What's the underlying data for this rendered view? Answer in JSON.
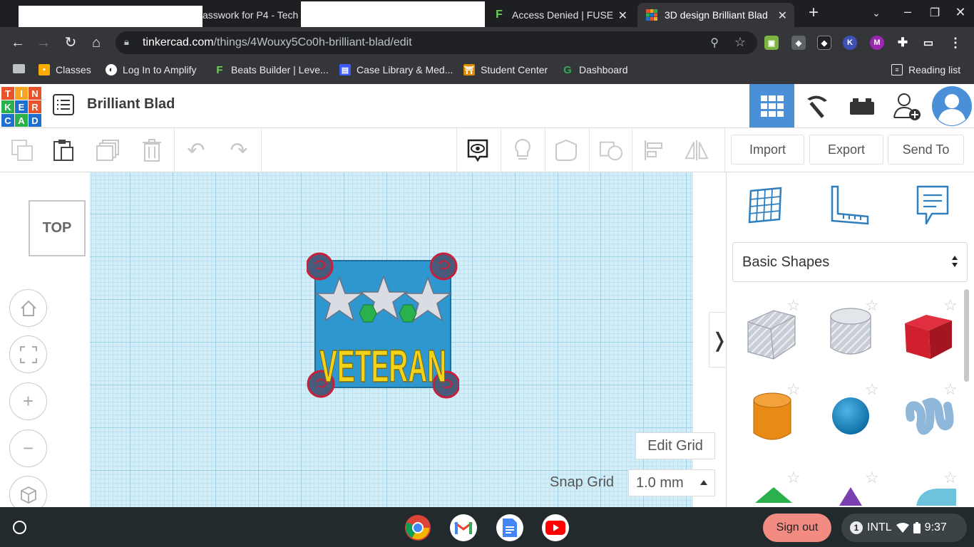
{
  "browser": {
    "tabs": [
      {
        "title": "asswork for P4 - Tech",
        "active": false
      },
      {
        "title": "Access Denied | FUSE",
        "active": false
      },
      {
        "title": "3D design Brilliant Blad",
        "active": true
      }
    ],
    "new_tab_icon": "plus-icon",
    "url_host": "tinkercad.com",
    "url_path": "/things/4Wouxy5Co0h-brilliant-blad/edit",
    "bookmarks": [
      {
        "label": "Classes"
      },
      {
        "label": "Log In to Amplify"
      },
      {
        "label": "Beats Builder | Leve..."
      },
      {
        "label": "Case Library & Med..."
      },
      {
        "label": "Student Center"
      },
      {
        "label": "Dashboard"
      }
    ],
    "reading_list": "Reading list"
  },
  "app": {
    "logo_letters": [
      "T",
      "I",
      "N",
      "K",
      "E",
      "R",
      "C",
      "A",
      "D"
    ],
    "design_title": "Brilliant Blad",
    "actions": {
      "import": "Import",
      "export": "Export",
      "send_to": "Send To"
    },
    "viewcube_label": "TOP",
    "model_text": "VETERAN",
    "edit_grid": "Edit Grid",
    "snap_grid_label": "Snap Grid",
    "snap_grid_value": "1.0 mm",
    "shape_category": "Basic Shapes",
    "colors": {
      "accent_blue": "#4a90d9",
      "workplane": "#d4edf7",
      "model_blue": "#2f97d0",
      "model_yellow": "#f2d21b",
      "box_red": "#d0202e",
      "cylinder_orange": "#e98a15",
      "sphere_blue": "#1b8fcf"
    }
  },
  "shelf": {
    "sign_out": "Sign out",
    "notification_count": "1",
    "input_method": "INTL",
    "time": "9:37"
  }
}
